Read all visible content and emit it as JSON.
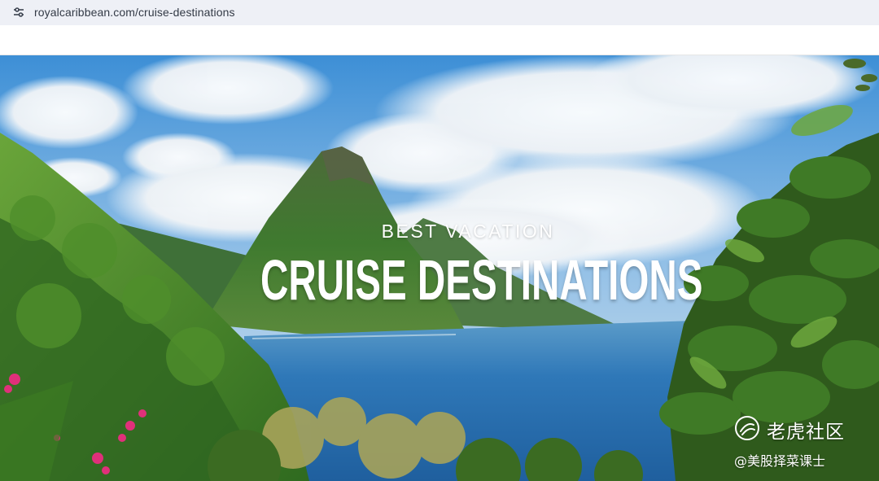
{
  "browser": {
    "url": "royalcaribbean.com/cruise-destinations",
    "site_icon": "tune-icon"
  },
  "hero": {
    "eyebrow": "BEST VACATION",
    "headline": "CRUISE DESTINATIONS",
    "image": "pitons-bay-landscape"
  },
  "watermark": {
    "logo_icon": "tiger-logo-icon",
    "title": "老虎社区",
    "subtitle": "@美股择菜课士"
  },
  "colors": {
    "address_bar_bg": "#eef0f6",
    "url_text": "#333a46",
    "hero_text": "#ffffff"
  }
}
